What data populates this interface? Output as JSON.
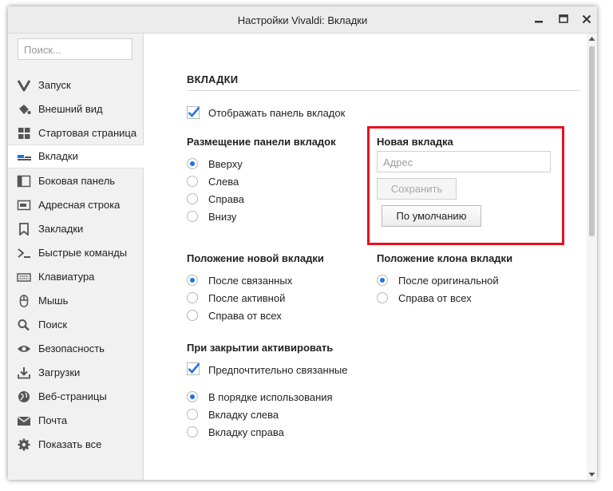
{
  "window": {
    "title": "Настройки Vivaldi: Вкладки"
  },
  "sidebar": {
    "search_placeholder": "Поиск...",
    "items": [
      {
        "label": "Запуск",
        "icon": "vivaldi-logo-icon"
      },
      {
        "label": "Внешний вид",
        "icon": "paint-bucket-icon"
      },
      {
        "label": "Стартовая страница",
        "icon": "grid-icon"
      },
      {
        "label": "Вкладки",
        "icon": "tabs-icon",
        "active": true
      },
      {
        "label": "Боковая панель",
        "icon": "panel-icon"
      },
      {
        "label": "Адресная строка",
        "icon": "address-bar-icon"
      },
      {
        "label": "Закладки",
        "icon": "bookmark-icon"
      },
      {
        "label": "Быстрые команды",
        "icon": "terminal-icon"
      },
      {
        "label": "Клавиатура",
        "icon": "keyboard-icon"
      },
      {
        "label": "Мышь",
        "icon": "mouse-icon"
      },
      {
        "label": "Поиск",
        "icon": "search-icon"
      },
      {
        "label": "Безопасность",
        "icon": "eye-icon"
      },
      {
        "label": "Загрузки",
        "icon": "download-icon"
      },
      {
        "label": "Веб-страницы",
        "icon": "globe-icon"
      },
      {
        "label": "Почта",
        "icon": "mail-icon"
      },
      {
        "label": "Показать все",
        "icon": "gear-icon"
      }
    ]
  },
  "main": {
    "section_title": "ВКЛАДКИ",
    "show_tab_bar": {
      "label": "Отображать панель вкладок",
      "checked": true
    },
    "tab_bar_position": {
      "heading": "Размещение панели вкладок",
      "options": [
        "Вверху",
        "Слева",
        "Справа",
        "Внизу"
      ],
      "selected": "Вверху"
    },
    "new_tab": {
      "heading": "Новая вкладка",
      "address_placeholder": "Адрес",
      "save_label": "Сохранить",
      "default_label": "По умолчанию"
    },
    "new_tab_position": {
      "heading": "Положение новой вкладки",
      "options": [
        "После связанных",
        "После активной",
        "Справа от всех"
      ],
      "selected": "После связанных"
    },
    "clone_tab_position": {
      "heading": "Положение клона вкладки",
      "options": [
        "После оригинальной",
        "Справа от всех"
      ],
      "selected": "После оригинальной"
    },
    "on_close_activate": {
      "heading": "При закрытии активировать",
      "prefer_related": {
        "label": "Предпочтительно связанные",
        "checked": true
      },
      "options": [
        "В порядке использования",
        "Вкладку слева",
        "Вкладку справа"
      ],
      "selected": "В порядке использования"
    }
  },
  "colors": {
    "accent": "#1a73e8",
    "highlight_box": "#e8101c"
  }
}
